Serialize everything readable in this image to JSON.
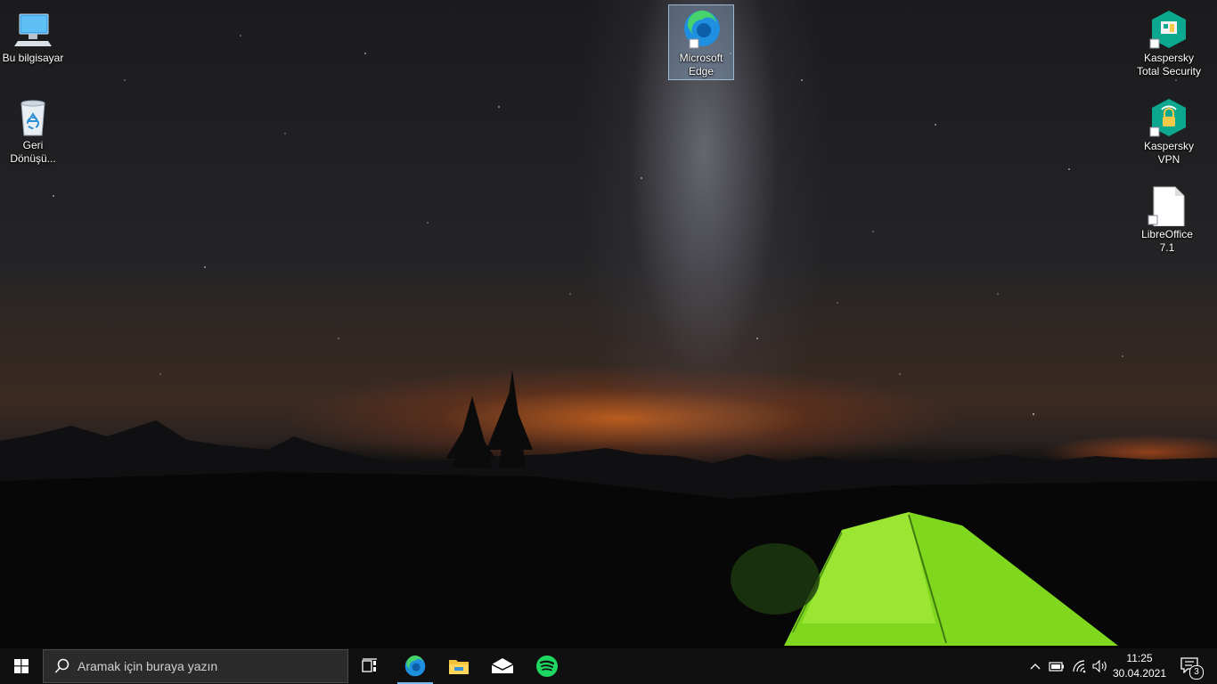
{
  "desktop": {
    "icons": [
      {
        "label": "Bu bilgisayar",
        "icon": "this-pc-icon"
      },
      {
        "label": "Geri Dönüşü...",
        "icon": "recycle-bin-icon"
      },
      {
        "label": "Microsoft Edge",
        "icon": "edge-icon",
        "selected": true
      },
      {
        "label": "Kaspersky Total Security",
        "icon": "kaspersky-total-security-icon"
      },
      {
        "label": "Kaspersky VPN",
        "icon": "kaspersky-vpn-icon"
      },
      {
        "label": "LibreOffice 7.1",
        "icon": "libreoffice-icon"
      }
    ]
  },
  "taskbar": {
    "start_icon": "windows-start-icon",
    "search_placeholder": "Aramak için buraya yazın",
    "apps": [
      {
        "name": "Task View",
        "icon": "task-view-icon"
      },
      {
        "name": "Microsoft Edge",
        "icon": "edge-icon",
        "active": true
      },
      {
        "name": "File Explorer",
        "icon": "folder-icon"
      },
      {
        "name": "Mail",
        "icon": "mail-icon"
      },
      {
        "name": "Spotify",
        "icon": "spotify-icon"
      }
    ],
    "tray": {
      "time": "11:25",
      "date": "30.04.2021",
      "notification_count": "3"
    }
  },
  "colors": {
    "taskbar": "#101010",
    "accent": "#76b9ed",
    "kaspersky": "#0ba88f",
    "spotify": "#1ed760"
  }
}
